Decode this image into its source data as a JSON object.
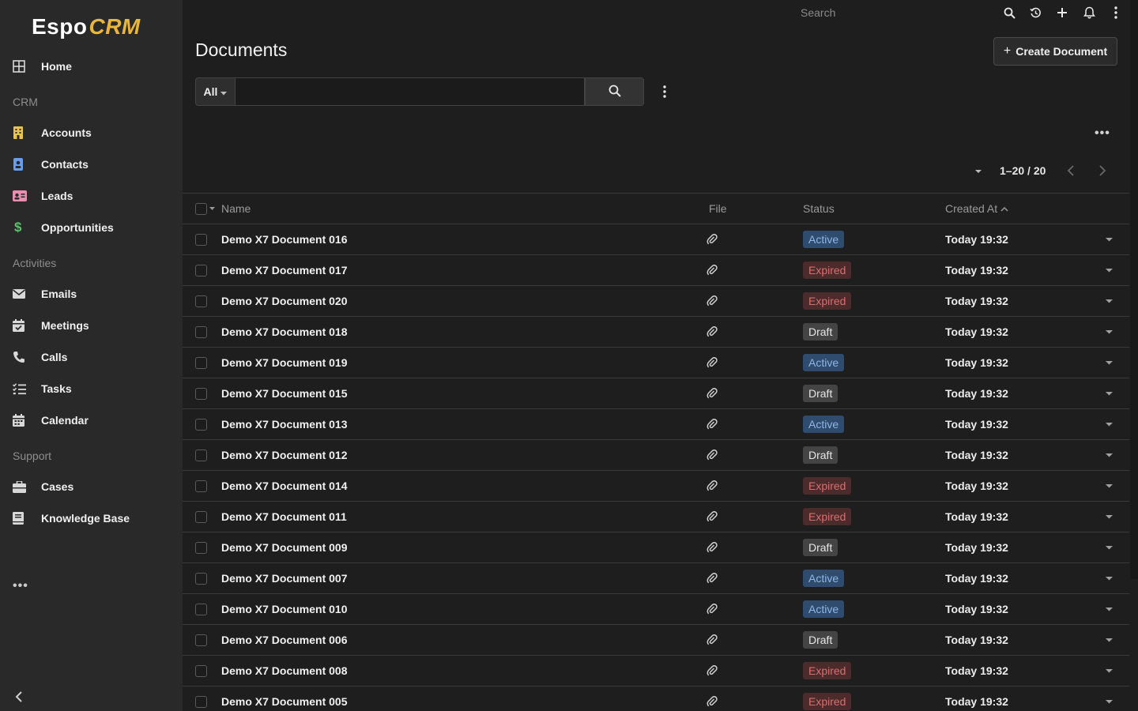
{
  "app": {
    "logo_espo": "Espo",
    "logo_crm": "CRM"
  },
  "sidebar": {
    "home": "Home",
    "groups": {
      "crm": "CRM",
      "activities": "Activities",
      "support": "Support"
    },
    "items": {
      "accounts": "Accounts",
      "contacts": "Contacts",
      "leads": "Leads",
      "opportunities": "Opportunities",
      "emails": "Emails",
      "meetings": "Meetings",
      "calls": "Calls",
      "tasks": "Tasks",
      "calendar": "Calendar",
      "cases": "Cases",
      "knowledge_base": "Knowledge Base"
    },
    "more": "•••",
    "icon_colors": {
      "accounts": "#e8c44a",
      "contacts": "#6b9ee8",
      "leads": "#e88fb0",
      "opportunities": "#5fbf6a"
    }
  },
  "topbar": {
    "search_placeholder": "Search"
  },
  "header": {
    "title": "Documents",
    "create_label": "Create Document"
  },
  "filter": {
    "scope_label": "All",
    "input_value": ""
  },
  "pager": {
    "text": "1–20 / 20"
  },
  "list_more": "•••",
  "table": {
    "columns": {
      "name": "Name",
      "file": "File",
      "status": "Status",
      "created_at": "Created At"
    },
    "rows": [
      {
        "name": "Demo X7 Document 016",
        "status": "Active",
        "created": "Today 19:32"
      },
      {
        "name": "Demo X7 Document 017",
        "status": "Expired",
        "created": "Today 19:32"
      },
      {
        "name": "Demo X7 Document 020",
        "status": "Expired",
        "created": "Today 19:32"
      },
      {
        "name": "Demo X7 Document 018",
        "status": "Draft",
        "created": "Today 19:32"
      },
      {
        "name": "Demo X7 Document 019",
        "status": "Active",
        "created": "Today 19:32"
      },
      {
        "name": "Demo X7 Document 015",
        "status": "Draft",
        "created": "Today 19:32"
      },
      {
        "name": "Demo X7 Document 013",
        "status": "Active",
        "created": "Today 19:32"
      },
      {
        "name": "Demo X7 Document 012",
        "status": "Draft",
        "created": "Today 19:32"
      },
      {
        "name": "Demo X7 Document 014",
        "status": "Expired",
        "created": "Today 19:32"
      },
      {
        "name": "Demo X7 Document 011",
        "status": "Expired",
        "created": "Today 19:32"
      },
      {
        "name": "Demo X7 Document 009",
        "status": "Draft",
        "created": "Today 19:32"
      },
      {
        "name": "Demo X7 Document 007",
        "status": "Active",
        "created": "Today 19:32"
      },
      {
        "name": "Demo X7 Document 010",
        "status": "Active",
        "created": "Today 19:32"
      },
      {
        "name": "Demo X7 Document 006",
        "status": "Draft",
        "created": "Today 19:32"
      },
      {
        "name": "Demo X7 Document 008",
        "status": "Expired",
        "created": "Today 19:32"
      },
      {
        "name": "Demo X7 Document 005",
        "status": "Expired",
        "created": "Today 19:32"
      }
    ]
  }
}
